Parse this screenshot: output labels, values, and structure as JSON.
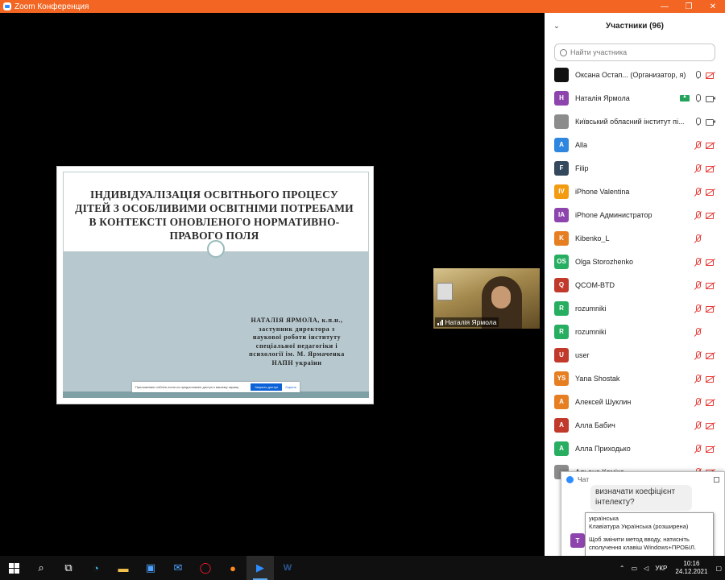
{
  "window": {
    "title": "Zoom Конференция"
  },
  "slide": {
    "title": "ІНДИВІДУАЛІЗАЦІЯ ОСВІТНЬОГО ПРОЦЕСУ ДІТЕЙ З ОСОБЛИВИМИ ОСВІТНІМИ ПОТРЕБАМИ В КОНТЕКСТІ ОНОВЛЕНОГО НОРМАТИВНО-ПРАВОГО ПОЛЯ",
    "author_lines": [
      "НАТАЛІЯ ЯРМОЛА, к.п.н.,",
      "заступник директора з",
      "наукової роботи інституту",
      "спеціальної педагогіки і",
      "психології ім. М. Ярмаченка",
      "НАПН україни"
    ],
    "notice_text": "Приложению onDrive.zoom.us предоставлен доступ к вашему экрану.",
    "notice_button": "Закрыть доступ",
    "notice_link": "Скрыть"
  },
  "video": {
    "name": "Наталія Ярмола"
  },
  "participants": {
    "title": "Участники (96)",
    "search_placeholder": "Найти участника",
    "items": [
      {
        "initials": "",
        "name": "Оксана Остап... (Организатор, я)",
        "color": "#111111",
        "mic": "on",
        "cam": "off",
        "share": false
      },
      {
        "initials": "Н",
        "name": "Наталія Ярмола",
        "color": "#8e44ad",
        "mic": "on",
        "cam": "on",
        "share": true
      },
      {
        "initials": "",
        "name": "Київський обласний інститут пі...",
        "color": "#8c8c8c",
        "mic": "on",
        "cam": "on",
        "share": false
      },
      {
        "initials": "A",
        "name": "Alla",
        "color": "#2e86de",
        "mic": "off",
        "cam": "off",
        "share": false
      },
      {
        "initials": "F",
        "name": "Filip",
        "color": "#34495e",
        "mic": "off",
        "cam": "off",
        "share": false
      },
      {
        "initials": "IV",
        "name": "iPhone Valentina",
        "color": "#f39c12",
        "mic": "off",
        "cam": "off",
        "share": false
      },
      {
        "initials": "IA",
        "name": "iPhone Администратор",
        "color": "#8e44ad",
        "mic": "off",
        "cam": "off",
        "share": false
      },
      {
        "initials": "K",
        "name": "Kibenko_L",
        "color": "#e67e22",
        "mic": "off",
        "cam": "none",
        "share": false
      },
      {
        "initials": "OS",
        "name": "Olga  Storozhenko",
        "color": "#27ae60",
        "mic": "off",
        "cam": "off",
        "share": false
      },
      {
        "initials": "Q",
        "name": "QCOM-BTD",
        "color": "#c0392b",
        "mic": "off",
        "cam": "off",
        "share": false
      },
      {
        "initials": "R",
        "name": "rozumniki",
        "color": "#27ae60",
        "mic": "off",
        "cam": "off",
        "share": false
      },
      {
        "initials": "R",
        "name": "rozumniki",
        "color": "#27ae60",
        "mic": "off",
        "cam": "none",
        "share": false
      },
      {
        "initials": "U",
        "name": "user",
        "color": "#c0392b",
        "mic": "off",
        "cam": "off",
        "share": false
      },
      {
        "initials": "YS",
        "name": "Yana Shostak",
        "color": "#e67e22",
        "mic": "off",
        "cam": "off",
        "share": false
      },
      {
        "initials": "А",
        "name": "Алексей Шуклин",
        "color": "#e67e22",
        "mic": "off",
        "cam": "off",
        "share": false
      },
      {
        "initials": "А",
        "name": "Алла Бабич",
        "color": "#c0392b",
        "mic": "off",
        "cam": "off",
        "share": false
      },
      {
        "initials": "А",
        "name": "Алла Приходько",
        "color": "#27ae60",
        "mic": "off",
        "cam": "off",
        "share": false
      },
      {
        "initials": "",
        "name": "Альона Коміко",
        "color": "#8c8c8c",
        "mic": "off",
        "cam": "off",
        "share": false
      }
    ]
  },
  "chat": {
    "title": "Чат",
    "message": "визначати коефіцієнт інтелекту?",
    "avatar_initial": "Т"
  },
  "ime_tooltip": {
    "line1": "українська",
    "line2": "Клавіатура Українська (розширена)",
    "line3": "Щоб змінити метод вводу, натисніть",
    "line4": "сполучення клавіш Windows+ПРОБІЛ."
  },
  "taskbar": {
    "lang": "УКР",
    "time": "10:16",
    "date": "24.12.2021"
  }
}
